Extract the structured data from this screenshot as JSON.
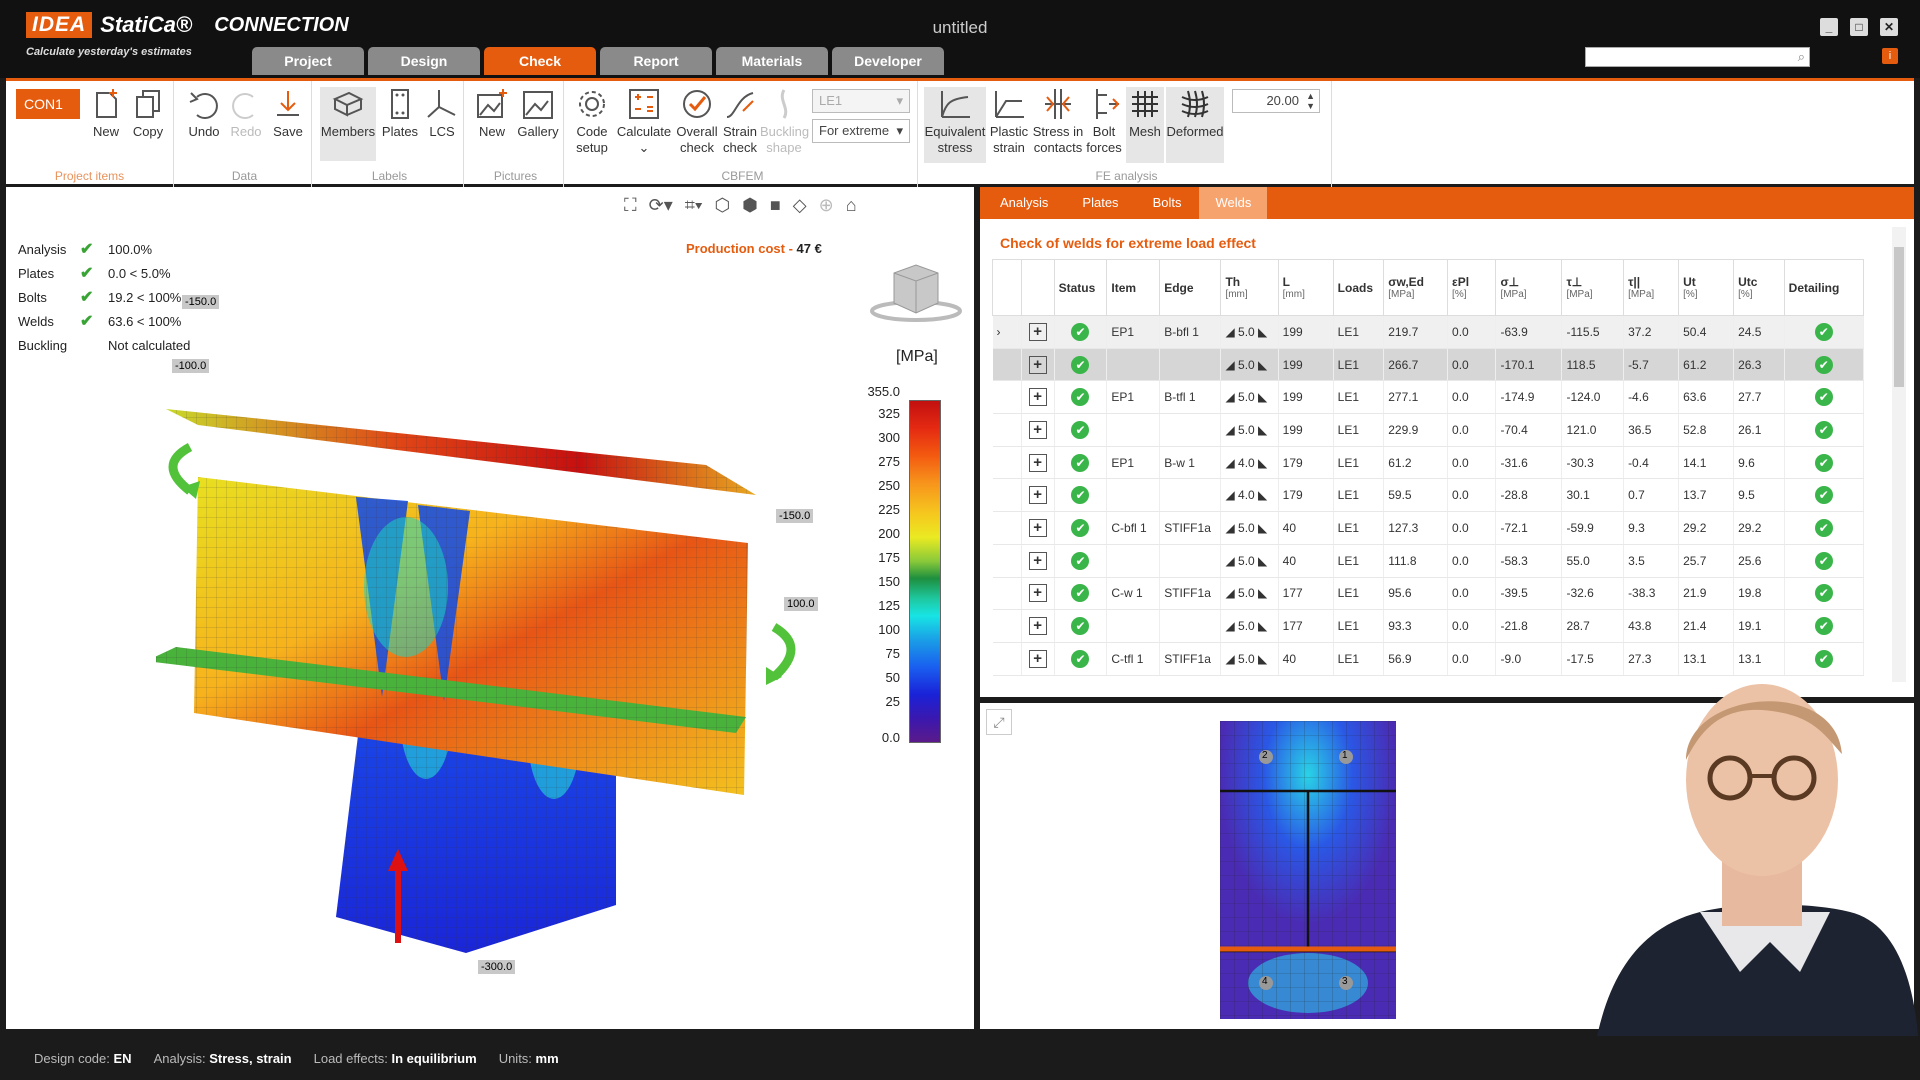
{
  "app": {
    "brand_idea": "IDEA",
    "brand_statica": "StatiCa®",
    "product": "CONNECTION",
    "tagline": "Calculate yesterday's estimates",
    "doc_title": "untitled",
    "accent": "#e65c0f"
  },
  "tabs": [
    "Project",
    "Design",
    "Check",
    "Report",
    "Materials",
    "Developer"
  ],
  "ribbon": {
    "con": "CON1",
    "project_items": {
      "label": "Project items",
      "new": "New",
      "copy": "Copy"
    },
    "data": {
      "label": "Data",
      "undo": "Undo",
      "redo": "Redo",
      "save": "Save"
    },
    "labels": {
      "label": "Labels",
      "members": "Members",
      "plates": "Plates",
      "lcs": "LCS"
    },
    "pictures": {
      "label": "Pictures",
      "new": "New",
      "gallery": "Gallery"
    },
    "cbfem": {
      "label": "CBFEM",
      "code_setup_1": "Code",
      "code_setup_2": "setup",
      "calculate": "Calculate",
      "overall_1": "Overall",
      "overall_2": "check",
      "strain_1": "Strain",
      "strain_2": "check",
      "buckling_1": "Buckling",
      "buckling_2": "shape",
      "le_value": "LE1",
      "extreme_value": "For extreme"
    },
    "fe": {
      "label": "FE analysis",
      "eq_1": "Equivalent",
      "eq_2": "stress",
      "plastic_1": "Plastic",
      "plastic_2": "strain",
      "contacts_1": "Stress in",
      "contacts_2": "contacts",
      "bolt_1": "Bolt",
      "bolt_2": "forces",
      "mesh": "Mesh",
      "deformed": "Deformed",
      "scale_value": "20.00"
    }
  },
  "summary": [
    {
      "label": "Analysis",
      "check": "✔",
      "value": "100.0%"
    },
    {
      "label": "Plates",
      "check": "✔",
      "value": "0.0 < 5.0%"
    },
    {
      "label": "Bolts",
      "check": "✔",
      "value": "19.2 < 100%"
    },
    {
      "label": "Welds",
      "check": "✔",
      "value": "63.6 < 100%"
    },
    {
      "label": "Buckling",
      "check": "",
      "value": "Not calculated"
    }
  ],
  "production_cost": {
    "label": "Production cost",
    "sep": "-",
    "value": "47 €"
  },
  "loads": {
    "a": "-150.0",
    "b": "-100.0",
    "c": "-150.0",
    "d": "100.0",
    "e": "-300.0"
  },
  "legend": {
    "unit": "[MPa]",
    "ticks": [
      "355.0",
      "325",
      "300",
      "275",
      "250",
      "225",
      "200",
      "175",
      "150",
      "125",
      "100",
      "75",
      "50",
      "25",
      "0.0"
    ]
  },
  "right_tabs": [
    "Analysis",
    "Plates",
    "Bolts",
    "Welds"
  ],
  "welds": {
    "heading": "Check of welds for extreme load effect",
    "columns": [
      {
        "name": "",
        "unit": ""
      },
      {
        "name": "",
        "unit": ""
      },
      {
        "name": "Status",
        "unit": ""
      },
      {
        "name": "Item",
        "unit": ""
      },
      {
        "name": "Edge",
        "unit": ""
      },
      {
        "name": "Th",
        "unit": "[mm]"
      },
      {
        "name": "L",
        "unit": "[mm]"
      },
      {
        "name": "Loads",
        "unit": ""
      },
      {
        "name": "σw,Ed",
        "unit": "[MPa]"
      },
      {
        "name": "εPl",
        "unit": "[%]"
      },
      {
        "name": "σ⊥",
        "unit": "[MPa]"
      },
      {
        "name": "τ⊥",
        "unit": "[MPa]"
      },
      {
        "name": "τ||",
        "unit": "[MPa]"
      },
      {
        "name": "Ut",
        "unit": "[%]"
      },
      {
        "name": "Utc",
        "unit": "[%]"
      },
      {
        "name": "Detailing",
        "unit": ""
      }
    ],
    "rows": [
      {
        "exp": "›",
        "item": "EP1",
        "edge": "B-bfl 1",
        "th": "◢ 5.0 ◣",
        "l": "199",
        "loads": "LE1",
        "sw": "219.7",
        "ep": "0.0",
        "sp": "-63.9",
        "tp": "-115.5",
        "tpar": "37.2",
        "ut": "50.4",
        "utc": "24.5"
      },
      {
        "exp": "",
        "item": "",
        "edge": "",
        "th": "◢ 5.0 ◣",
        "l": "199",
        "loads": "LE1",
        "sw": "266.7",
        "ep": "0.0",
        "sp": "-170.1",
        "tp": "118.5",
        "tpar": "-5.7",
        "ut": "61.2",
        "utc": "26.3"
      },
      {
        "exp": "",
        "item": "EP1",
        "edge": "B-tfl 1",
        "th": "◢ 5.0 ◣",
        "l": "199",
        "loads": "LE1",
        "sw": "277.1",
        "ep": "0.0",
        "sp": "-174.9",
        "tp": "-124.0",
        "tpar": "-4.6",
        "ut": "63.6",
        "utc": "27.7"
      },
      {
        "exp": "",
        "item": "",
        "edge": "",
        "th": "◢ 5.0 ◣",
        "l": "199",
        "loads": "LE1",
        "sw": "229.9",
        "ep": "0.0",
        "sp": "-70.4",
        "tp": "121.0",
        "tpar": "36.5",
        "ut": "52.8",
        "utc": "26.1"
      },
      {
        "exp": "",
        "item": "EP1",
        "edge": "B-w 1",
        "th": "◢ 4.0 ◣",
        "l": "179",
        "loads": "LE1",
        "sw": "61.2",
        "ep": "0.0",
        "sp": "-31.6",
        "tp": "-30.3",
        "tpar": "-0.4",
        "ut": "14.1",
        "utc": "9.6"
      },
      {
        "exp": "",
        "item": "",
        "edge": "",
        "th": "◢ 4.0 ◣",
        "l": "179",
        "loads": "LE1",
        "sw": "59.5",
        "ep": "0.0",
        "sp": "-28.8",
        "tp": "30.1",
        "tpar": "0.7",
        "ut": "13.7",
        "utc": "9.5"
      },
      {
        "exp": "",
        "item": "C-bfl 1",
        "edge": "STIFF1a",
        "th": "◢ 5.0 ◣",
        "l": "40",
        "loads": "LE1",
        "sw": "127.3",
        "ep": "0.0",
        "sp": "-72.1",
        "tp": "-59.9",
        "tpar": "9.3",
        "ut": "29.2",
        "utc": "29.2"
      },
      {
        "exp": "",
        "item": "",
        "edge": "",
        "th": "◢ 5.0 ◣",
        "l": "40",
        "loads": "LE1",
        "sw": "111.8",
        "ep": "0.0",
        "sp": "-58.3",
        "tp": "55.0",
        "tpar": "3.5",
        "ut": "25.7",
        "utc": "25.6"
      },
      {
        "exp": "",
        "item": "C-w 1",
        "edge": "STIFF1a",
        "th": "◢ 5.0 ◣",
        "l": "177",
        "loads": "LE1",
        "sw": "95.6",
        "ep": "0.0",
        "sp": "-39.5",
        "tp": "-32.6",
        "tpar": "-38.3",
        "ut": "21.9",
        "utc": "19.8"
      },
      {
        "exp": "",
        "item": "",
        "edge": "",
        "th": "◢ 5.0 ◣",
        "l": "177",
        "loads": "LE1",
        "sw": "93.3",
        "ep": "0.0",
        "sp": "-21.8",
        "tp": "28.7",
        "tpar": "43.8",
        "ut": "21.4",
        "utc": "19.1"
      },
      {
        "exp": "",
        "item": "C-tfl 1",
        "edge": "STIFF1a",
        "th": "◢ 5.0 ◣",
        "l": "40",
        "loads": "LE1",
        "sw": "56.9",
        "ep": "0.0",
        "sp": "-9.0",
        "tp": "-17.5",
        "tpar": "27.3",
        "ut": "13.1",
        "utc": "13.1"
      }
    ]
  },
  "plate_view": {
    "bolts": [
      "2",
      "1",
      "4",
      "3"
    ]
  },
  "status": {
    "design_code_label": "Design code:",
    "design_code": "EN",
    "analysis_label": "Analysis:",
    "analysis": "Stress, strain",
    "load_label": "Load effects:",
    "load": "In equilibrium",
    "units_label": "Units:",
    "units": "mm"
  }
}
